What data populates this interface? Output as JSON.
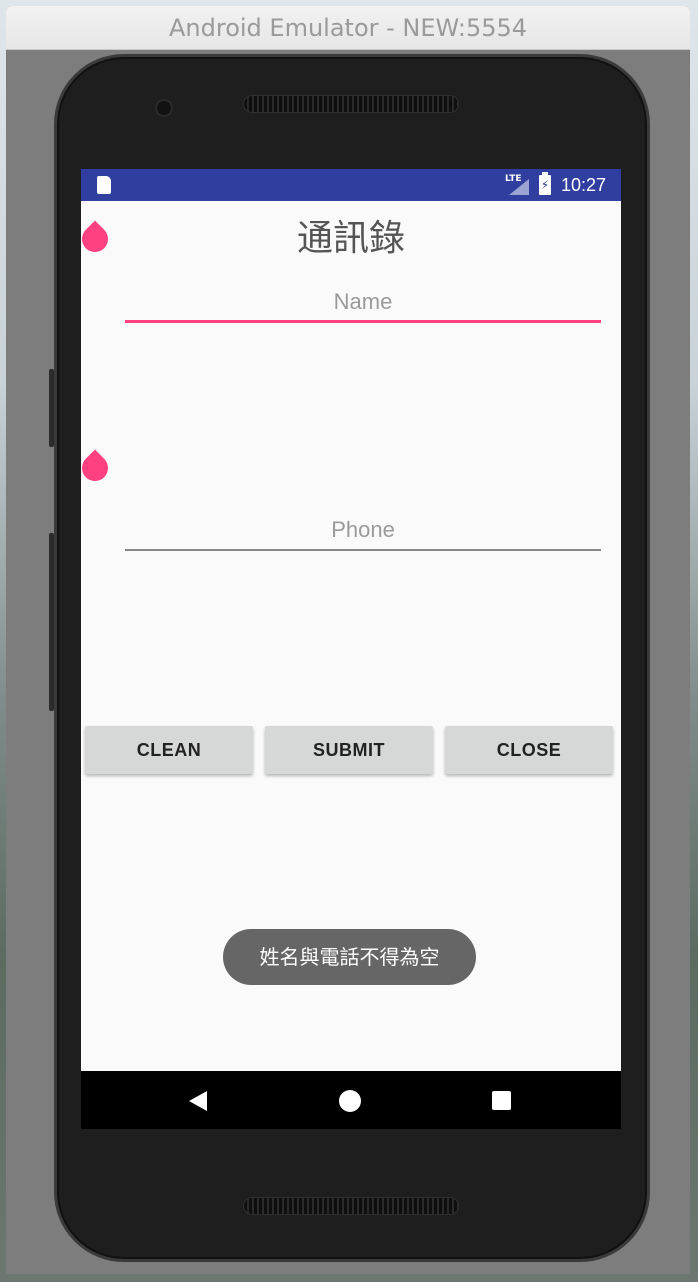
{
  "window": {
    "title": "Android Emulator - NEW:5554"
  },
  "statusbar": {
    "time": "10:27",
    "network": "LTE",
    "color": "#303f9f"
  },
  "app": {
    "title": "通訊錄",
    "name_field": {
      "placeholder": "Name",
      "value": ""
    },
    "phone_field": {
      "placeholder": "Phone",
      "value": ""
    },
    "buttons": {
      "clean": "CLEAN",
      "submit": "SUBMIT",
      "close": "CLOSE"
    },
    "toast": "姓名與電話不得為空",
    "accent_color": "#ff4081"
  },
  "navbar": {
    "back_icon": "triangle-back-icon",
    "home_icon": "circle-home-icon",
    "recents_icon": "square-recents-icon"
  }
}
